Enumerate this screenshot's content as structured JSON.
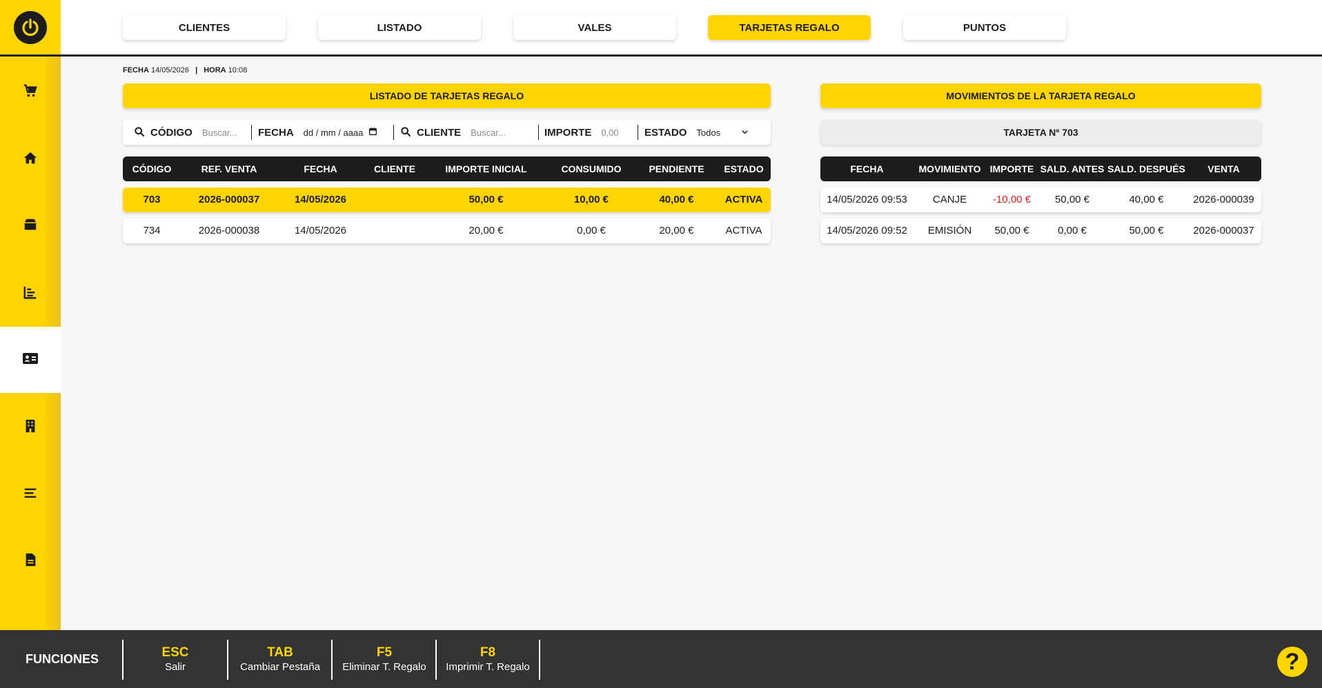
{
  "tabs": [
    {
      "label": "CLIENTES"
    },
    {
      "label": "LISTADO"
    },
    {
      "label": "VALES"
    },
    {
      "label": "TARJETAS REGALO"
    },
    {
      "label": "PUNTOS"
    }
  ],
  "active_tab": "TARJETAS REGALO",
  "sidebar": {
    "items": [
      {
        "icon": "cart-icon"
      },
      {
        "icon": "home-icon"
      },
      {
        "icon": "box-icon"
      },
      {
        "icon": "bar-chart-icon"
      },
      {
        "icon": "id-card-icon"
      },
      {
        "icon": "building-icon"
      },
      {
        "icon": "menu-icon"
      },
      {
        "icon": "document-icon"
      }
    ]
  },
  "dateline": {
    "fecha_label": "FECHA",
    "fecha": "14/05/2026",
    "separator": "|",
    "hora_label": "HORA",
    "hora": "10:08"
  },
  "left": {
    "title": "LISTADO DE TARJETAS REGALO",
    "filters": {
      "codigo_label": "CÓDIGO",
      "codigo_placeholder": "Buscar...",
      "fecha_label": "FECHA",
      "fecha_placeholder": "dd / mm / aaaa",
      "cliente_label": "CLIENTE",
      "cliente_placeholder": "Buscar...",
      "importe_label": "IMPORTE",
      "importe_placeholder": "0,00",
      "estado_label": "ESTADO",
      "estado_value": "Todos"
    },
    "columns": [
      "CÓDIGO",
      "REF. VENTA",
      "FECHA",
      "CLIENTE",
      "IMPORTE INICIAL",
      "CONSUMIDO",
      "PENDIENTE",
      "ESTADO"
    ],
    "rows": [
      [
        "703",
        "2026-000037",
        "14/05/2026",
        "",
        "50,00 €",
        "10,00 €",
        "40,00 €",
        "ACTIVA"
      ],
      [
        "734",
        "2026-000038",
        "14/05/2026",
        "",
        "20,00 €",
        "0,00 €",
        "20,00 €",
        "ACTIVA"
      ]
    ]
  },
  "right": {
    "title": "MOVIMIENTOS DE LA TARJETA REGALO",
    "card_label": "TARJETA Nº 703",
    "columns": [
      "FECHA",
      "MOVIMIENTO",
      "IMPORTE",
      "SALD. ANTES",
      "SALD. DESPUÉS",
      "VENTA"
    ],
    "rows": [
      [
        "14/05/2026 09:53",
        "CANJE",
        "-10,00 €",
        "50,00 €",
        "40,00 €",
        "2026-000039"
      ],
      [
        "14/05/2026 09:52",
        "EMISIÓN",
        "50,00 €",
        "0,00 €",
        "50,00 €",
        "2026-000037"
      ]
    ]
  },
  "footer": {
    "title": "FUNCIONES",
    "keys": [
      {
        "key": "ESC",
        "desc": "Salir"
      },
      {
        "key": "TAB",
        "desc": "Cambiar Pestaña"
      },
      {
        "key": "F5",
        "desc": "Eliminar T. Regalo"
      },
      {
        "key": "F8",
        "desc": "Imprimir T. Regalo"
      }
    ],
    "help_symbol": "?"
  },
  "colors": {
    "accent": "#ffd400",
    "dark": "#1d1d1d",
    "footer": "#333333",
    "negative": "#e11b1b"
  }
}
